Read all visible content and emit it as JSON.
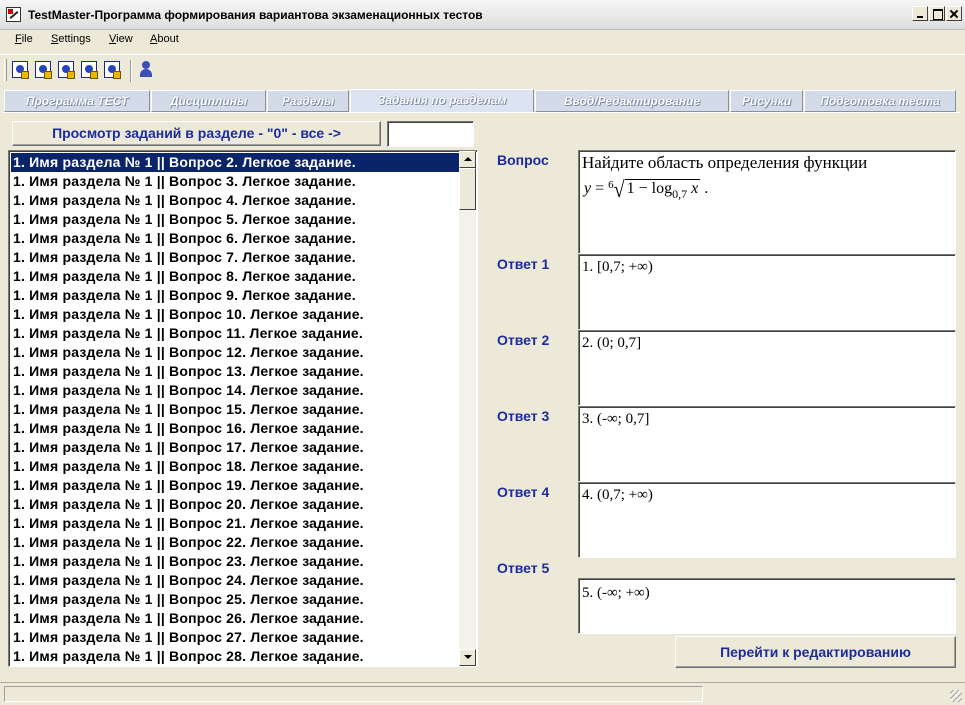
{
  "window": {
    "title": "TestMaster-Программа формирования вариантова экзаменационных тестов"
  },
  "menu": [
    {
      "label": "File",
      "mnemonic": "F",
      "rest": "ile"
    },
    {
      "label": "Settings",
      "mnemonic": "S",
      "rest": "ettings"
    },
    {
      "label": "View",
      "mnemonic": "V",
      "rest": "iew"
    },
    {
      "label": "About",
      "mnemonic": "A",
      "rest": "bout"
    }
  ],
  "toolbar": {
    "buttons": [
      "doc-icon",
      "doc-icon",
      "doc-icon",
      "doc-icon",
      "doc-icon"
    ],
    "user_icon": "user-icon"
  },
  "tabs": [
    {
      "label": "Программа ТЕСТ",
      "active": false
    },
    {
      "label": "Дисциплины",
      "active": false
    },
    {
      "label": "Разделы",
      "active": false
    },
    {
      "label": "Задания по разделам",
      "active": true
    },
    {
      "label": "Ввод/Редактирование",
      "active": false
    },
    {
      "label": "Рисунки",
      "active": false
    },
    {
      "label": "Подготовка теста",
      "active": false
    }
  ],
  "filter": {
    "button_label": "Просмотр заданий в разделе - \"0\" - все ->",
    "input_value": ""
  },
  "list": {
    "selected_index": 0,
    "items": [
      "1. Имя раздела № 1 || Вопрос 2. Легкое задание.",
      "1. Имя раздела № 1 || Вопрос 3. Легкое задание.",
      "1. Имя раздела № 1 || Вопрос 4. Легкое задание.",
      "1. Имя раздела № 1 || Вопрос 5. Легкое задание.",
      "1. Имя раздела № 1 || Вопрос 6. Легкое задание.",
      "1. Имя раздела № 1 || Вопрос 7. Легкое задание.",
      "1. Имя раздела № 1 || Вопрос 8. Легкое задание.",
      "1. Имя раздела № 1 || Вопрос 9. Легкое задание.",
      "1. Имя раздела № 1 || Вопрос 10. Легкое задание.",
      "1. Имя раздела № 1 || Вопрос 11. Легкое задание.",
      "1. Имя раздела № 1 || Вопрос 12. Легкое задание.",
      "1. Имя раздела № 1 || Вопрос 13. Легкое задание.",
      "1. Имя раздела № 1 || Вопрос 14. Легкое задание.",
      "1. Имя раздела № 1 || Вопрос 15. Легкое задание.",
      "1. Имя раздела № 1 || Вопрос 16. Легкое задание.",
      "1. Имя раздела № 1 || Вопрос 17. Легкое задание.",
      "1. Имя раздела № 1 || Вопрос 18. Легкое задание.",
      "1. Имя раздела № 1 || Вопрос 19. Легкое задание.",
      "1. Имя раздела № 1 || Вопрос 20. Легкое задание.",
      "1. Имя раздела № 1 || Вопрос 21. Легкое задание.",
      "1. Имя раздела № 1 || Вопрос 22. Легкое задание.",
      "1. Имя раздела № 1 || Вопрос 23. Легкое задание.",
      "1. Имя раздела № 1 || Вопрос 24. Легкое задание.",
      "1. Имя раздела № 1 || Вопрос 25. Легкое задание.",
      "1. Имя раздела № 1 || Вопрос 26. Легкое задание.",
      "1. Имя раздела № 1 || Вопрос 27. Легкое задание.",
      "1. Имя раздела № 1 || Вопрос 28. Легкое задание."
    ]
  },
  "question": {
    "label": "Вопрос",
    "text": "Найдите область определения функции",
    "formula": {
      "lhs": "y",
      "eq": "=",
      "root_index": "6",
      "one": "1",
      "minus": "−",
      "log": "log",
      "base": "0,7",
      "var": "x",
      "tail": "."
    }
  },
  "answers": [
    {
      "label": "Ответ 1",
      "text": "1. [0,7;  +∞)"
    },
    {
      "label": "Ответ 2",
      "text": "2. (0; 0,7]"
    },
    {
      "label": "Ответ 3",
      "text": "3. (-∞; 0,7]"
    },
    {
      "label": "Ответ 4",
      "text": "4. (0,7; +∞)"
    },
    {
      "label": "Ответ 5",
      "text": "5. (-∞; +∞)"
    }
  ],
  "edit_button": {
    "label": "Перейти к редактированию"
  },
  "status": {
    "text": ""
  },
  "colors": {
    "accent_text": "#1d2c9c",
    "selection": "#0a246a",
    "face": "#ece9d8"
  }
}
